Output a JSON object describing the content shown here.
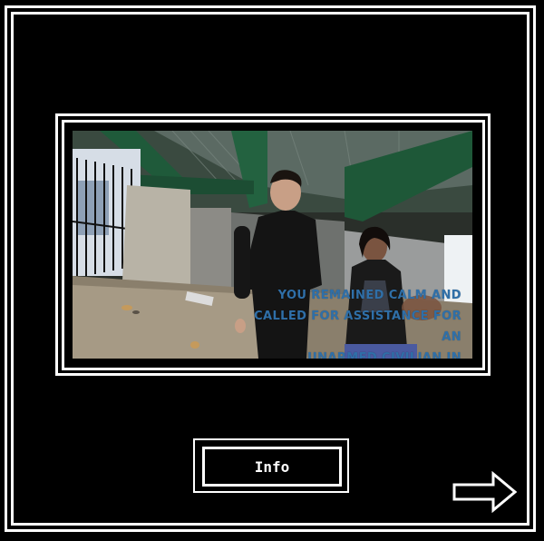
{
  "scene": {
    "caption": "YOU REMAINED CALM AND\nCALLED FOR ASSISTANCE FOR AN\nUNARMED CIVILIAN IN DISTRESS.",
    "caption_color": "#2f6fa8"
  },
  "controls": {
    "info_label": "Info",
    "next_icon": "right-arrow-icon"
  },
  "colors": {
    "background": "#000000",
    "frame": "#ffffff"
  }
}
